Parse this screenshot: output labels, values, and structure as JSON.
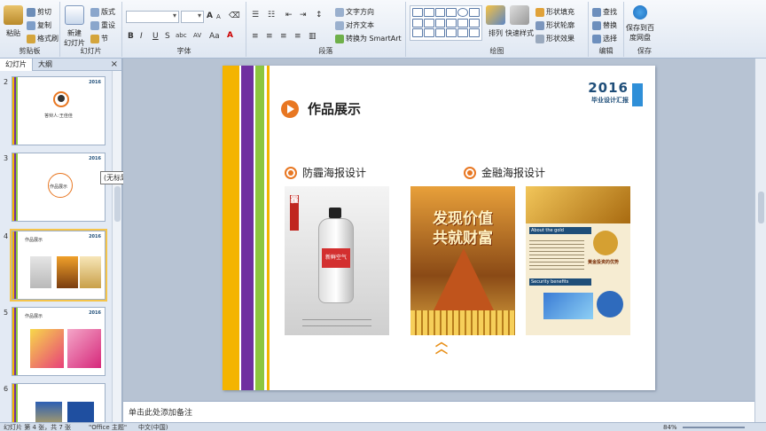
{
  "ribbon": {
    "clipboard": {
      "paste": "粘贴",
      "cut": "剪切",
      "copy": "复制",
      "format_painter": "格式刷",
      "label": "剪贴板"
    },
    "slides": {
      "new_slide": "新建\n幻灯片",
      "layout": "版式",
      "reset": "重设",
      "section": "节",
      "label": "幻灯片"
    },
    "font": {
      "label": "字体",
      "bold": "B",
      "italic": "I",
      "underline": "U",
      "strike": "S",
      "shadow": "abc",
      "spacing": "AV",
      "case": "Aa",
      "grow": "A",
      "shrink": "A"
    },
    "paragraph": {
      "label": "段落",
      "text_direction": "文字方向",
      "align_text": "对齐文本",
      "smartart": "转换为 SmartArt"
    },
    "drawing": {
      "label": "绘图",
      "arrange": "排列",
      "quick_styles": "快速样式",
      "shape_fill": "形状填充",
      "shape_outline": "形状轮廓",
      "shape_effects": "形状效果"
    },
    "editing": {
      "label": "编辑",
      "find": "查找",
      "replace": "替换",
      "select": "选择"
    },
    "save": {
      "label": "保存",
      "save_to_cloud": "保存到百\n度网盘"
    }
  },
  "left_panel": {
    "tab_slides": "幻灯片",
    "tab_outline": "大纲",
    "close": "×",
    "tooltip": "(无标题)",
    "thumbnails": [
      {
        "num": "2",
        "caption": "答辩人:王佳佳",
        "year": "2016"
      },
      {
        "num": "3",
        "caption": "作品展示",
        "year": "2016"
      },
      {
        "num": "4",
        "caption": "作品展示",
        "year": "2016"
      },
      {
        "num": "5",
        "caption": "作品展示",
        "year": "2016"
      },
      {
        "num": "6",
        "caption": "",
        "year": ""
      }
    ]
  },
  "slide": {
    "title": "作品展示",
    "year": "2016",
    "subtitle": "毕业设计汇报",
    "section1": "防霾海报设计",
    "section2": "金融海报设计",
    "poster_texts": {
      "vertical_red": "霾",
      "bottle_tag": "新鲜空气",
      "gold_headline_1": "发现价值",
      "gold_headline_2": "共就财富",
      "about_gold": "About the gold",
      "gold_subtitle": "黄金投资的优势",
      "security": "Security benefits"
    },
    "colors": {
      "yellow": "#f4b400",
      "purple": "#7030a0",
      "green": "#8dc63f",
      "orange": "#e87722",
      "navy": "#1f4e79",
      "blue": "#2f8fd8"
    }
  },
  "notes": {
    "placeholder": "单击此处添加备注"
  },
  "status": {
    "slide_info": "幻灯片 第 4 张，共 7 张",
    "theme": "\"Office 主题\"",
    "language": "中文(中国)",
    "zoom": "84%"
  }
}
